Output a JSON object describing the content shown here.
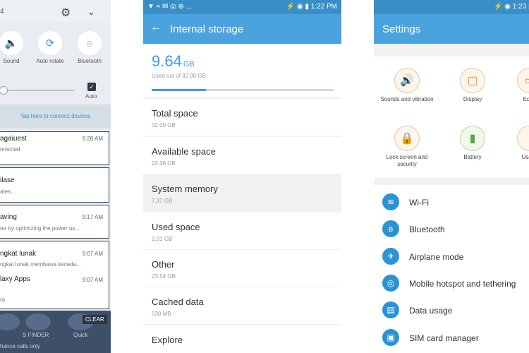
{
  "notification_panel": {
    "status_time": "4",
    "quick_toggles": [
      {
        "label": "Sound",
        "icon": "speaker-icon",
        "active": true
      },
      {
        "label": "Auto rotate",
        "icon": "rotate-icon",
        "active": true
      },
      {
        "label": "Bluetooth",
        "icon": "bluetooth-icon",
        "active": false
      }
    ],
    "brightness_level": 0.02,
    "auto_label": "Auto",
    "connect_text": "Tap here to connect devices",
    "notifications": [
      {
        "title": "agaiuest",
        "subtitle": "nnected",
        "time": "9:28 AM"
      },
      {
        "title": "ilase",
        "subtitle": "ates...",
        "time": ""
      },
      {
        "title": "aving",
        "subtitle": "ter by optimizing the power us...",
        "time": "9:17 AM"
      },
      {
        "title": "ngkat lunak",
        "subtitle": "ngkat lunak membawa keceda...",
        "time": "9:07 AM"
      },
      {
        "title": "laxy Apps",
        "subtitle": "ra",
        "time": "9:07 AM"
      }
    ],
    "bottom_labels": {
      "left": "S FINDER",
      "right": "Quick",
      "footer": "hance calls only"
    },
    "clear_label": "CLEAR"
  },
  "storage_screen": {
    "status": "▼ ≈ ✉ ◎ ⊕ ...",
    "status_right": "⚡ ◉ ▮ 1:22 PM",
    "title": "Internal storage",
    "total_value": "9.64",
    "total_unit": "GB",
    "used_text": "Used out of 32.00 GB",
    "usage_fraction": 0.3,
    "rows": [
      {
        "label": "Total space",
        "value": "32.00 GB"
      },
      {
        "label": "Available space",
        "value": "22.36 GB"
      },
      {
        "label": "System memory",
        "value": "7.37 GB"
      },
      {
        "label": "Used space",
        "value": "2.31 GB"
      },
      {
        "label": "Other",
        "value": "23.54 GB"
      },
      {
        "label": "Cached data",
        "value": "530 MB"
      },
      {
        "label": "Explore",
        "value": ""
      }
    ]
  },
  "settings_screen": {
    "status": "⚡ ◉ 1:23 ▮",
    "title": "Settings",
    "grid": [
      {
        "label": "Sounds and vibration",
        "icon": "speaker-icon",
        "symbol": "🔊",
        "tone": "orange"
      },
      {
        "label": "Display",
        "icon": "display-icon",
        "symbol": "▢",
        "tone": "orange"
      },
      {
        "label": "Edge",
        "icon": "edge-icon",
        "symbol": "▭",
        "tone": "orange"
      },
      {
        "label": "Lock screen and security",
        "icon": "lock-icon",
        "symbol": "🔒",
        "tone": "orange"
      },
      {
        "label": "Battery",
        "icon": "battery-icon",
        "symbol": "▮",
        "tone": "green"
      },
      {
        "label": "Usage",
        "icon": "usage-icon",
        "symbol": "◔",
        "tone": "orange"
      }
    ],
    "list": [
      {
        "label": "Wi-Fi",
        "icon": "wifi-icon",
        "symbol": "≋"
      },
      {
        "label": "Bluetooth",
        "icon": "bluetooth-icon",
        "symbol": "ʙ"
      },
      {
        "label": "Airplane mode",
        "icon": "airplane-icon",
        "symbol": "✈"
      },
      {
        "label": "Mobile hotspot and tethering",
        "icon": "hotspot-icon",
        "symbol": "◎"
      },
      {
        "label": "Data usage",
        "icon": "data-usage-icon",
        "symbol": "▤"
      },
      {
        "label": "SIM card manager",
        "icon": "sim-card-icon",
        "symbol": "▣"
      }
    ]
  }
}
